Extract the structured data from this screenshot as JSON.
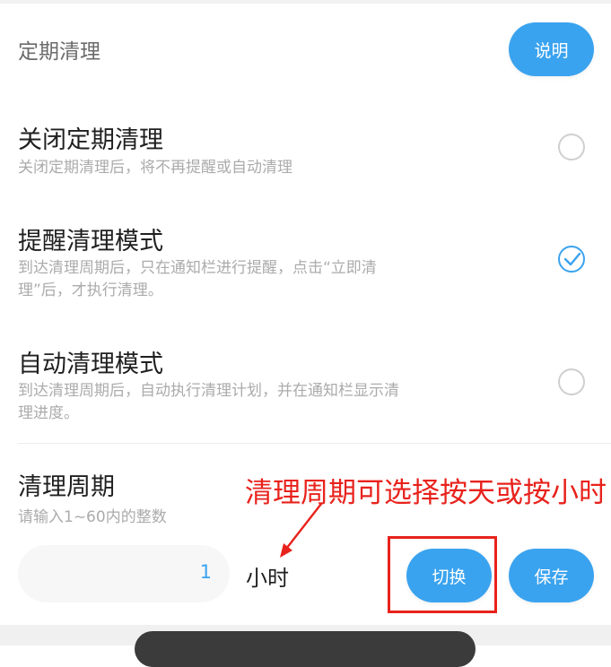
{
  "header": {
    "section_title": "定期清理",
    "help_button": "说明"
  },
  "options": [
    {
      "title": "关闭定期清理",
      "desc": "关闭定期清理后，将不再提醒或自动清理",
      "selected": false
    },
    {
      "title": "提醒清理模式",
      "desc": "到达清理周期后，只在通知栏进行提醒，点击“立即清理”后，才执行清理。",
      "selected": true
    },
    {
      "title": "自动清理模式",
      "desc": "到达清理周期后，自动执行清理计划，并在通知栏显示清理进度。",
      "selected": false
    }
  ],
  "period": {
    "title": "清理周期",
    "hint": "请输入1~60内的整数",
    "value": "1",
    "unit": "小时",
    "switch_button": "切换",
    "save_button": "保存"
  },
  "annotation": {
    "text": "清理周期可选择按天或按小时",
    "color": "#e8221c"
  },
  "colors": {
    "accent": "#3aa3ef"
  },
  "icons": {
    "check": "check-icon"
  }
}
